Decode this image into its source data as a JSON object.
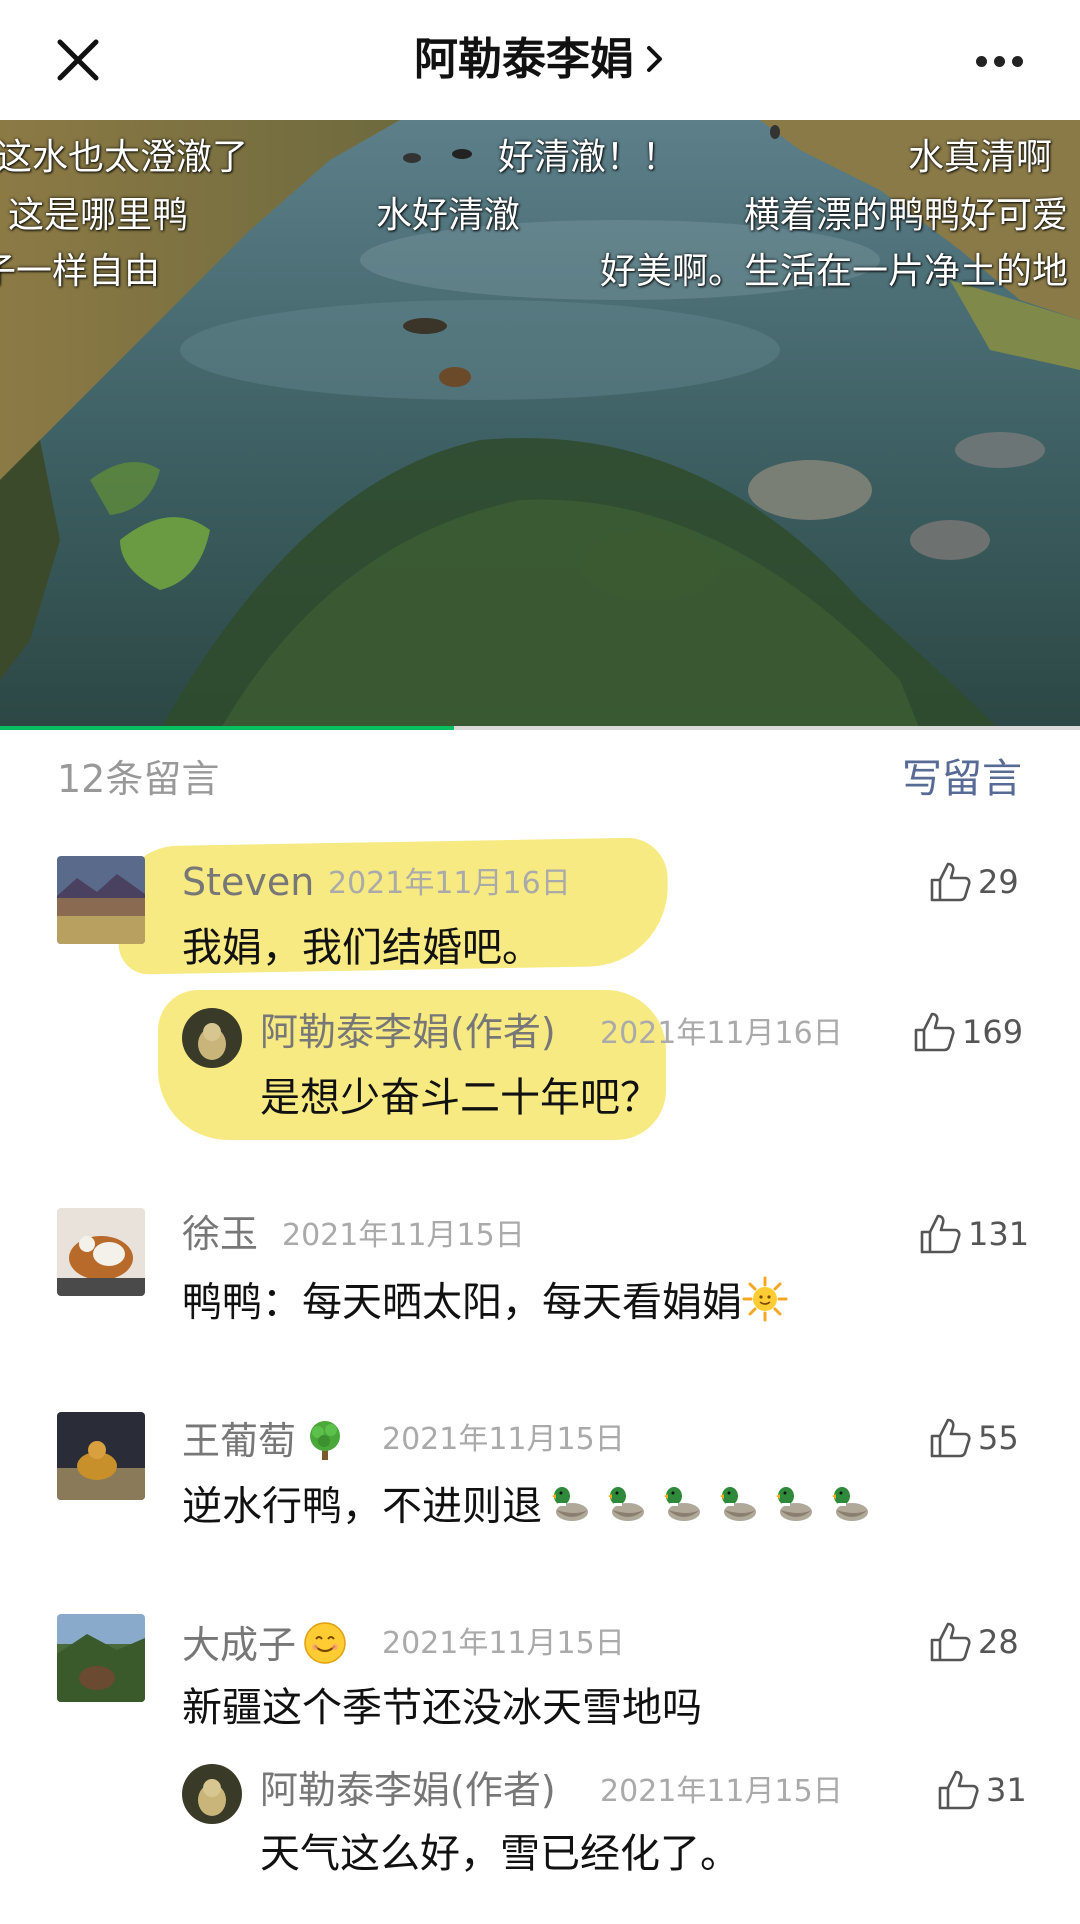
{
  "header": {
    "title": "阿勒泰李娟",
    "title_chevron": "›"
  },
  "video": {
    "progress_fraction": 0.42,
    "danmaku": [
      "这水也太澄澈了",
      "好清澈！！",
      "水真清啊",
      "这是哪里鸭",
      "水好清澈",
      "横着漂的鸭鸭好可爱",
      "子一样自由",
      "好美啊。生活在一片净土的地"
    ]
  },
  "comments_header": {
    "count": "12条留言",
    "write": "写留言"
  },
  "comments": [
    {
      "name": "Steven",
      "date": "2021年11月16日",
      "text": "我娟，我们结婚吧。",
      "likes": "29",
      "reply": {
        "name": "阿勒泰李娟(作者)",
        "date": "2021年11月16日",
        "text": "是想少奋斗二十年吧？",
        "likes": "169"
      }
    },
    {
      "name": "徐玉",
      "date": "2021年11月15日",
      "text": "鸭鸭：每天晒太阳，每天看娟娟",
      "likes": "131"
    },
    {
      "name": "王葡萄",
      "date": "2021年11月15日",
      "text": "逆水行鸭，不进则退",
      "likes": "55"
    },
    {
      "name": "大成子",
      "date": "2021年11月15日",
      "text": "新疆这个季节还没冰天雪地吗",
      "likes": "28",
      "reply": {
        "name": "阿勒泰李娟(作者)",
        "date": "2021年11月15日",
        "text": "天气这么好，雪已经化了。",
        "likes": "31"
      }
    }
  ],
  "colors": {
    "accent_green": "#07c160",
    "link_blue": "#576b95",
    "highlight_yellow": "#f7e66c"
  },
  "icons": [
    "close-icon",
    "chevron-right-icon",
    "more-icon",
    "thumbs-up-icon",
    "sun-emoji",
    "tree-emoji",
    "smile-emoji",
    "duck-emoji"
  ]
}
